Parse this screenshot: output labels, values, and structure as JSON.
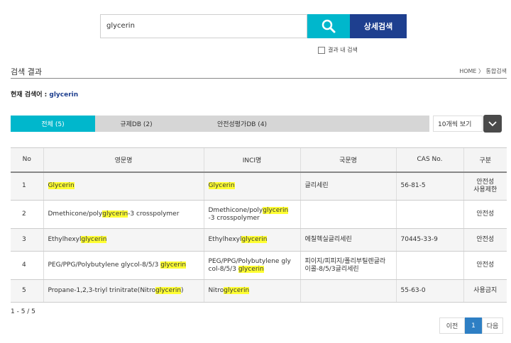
{
  "search": {
    "query": "glycerin",
    "advanced_label": "상세검색",
    "within_label": "결과 내 검색"
  },
  "section": {
    "title": "검색 결과",
    "breadcrumb": "HOME 〉 통합검색"
  },
  "keyword": {
    "label": "현재 검색어 : ",
    "value": "glycerin"
  },
  "tabs": [
    {
      "label": "전체 (5)"
    },
    {
      "label": "규제DB (2)"
    },
    {
      "label": "안전성평가DB (4)"
    }
  ],
  "per_page": {
    "selected": "10개씩 보기"
  },
  "table": {
    "headers": [
      "No",
      "영문명",
      "INCI명",
      "국문명",
      "CAS No.",
      "구분"
    ],
    "rows": [
      {
        "no": "1",
        "en": [
          "",
          "Glycerin",
          ""
        ],
        "inci": [
          "",
          "Glycerin",
          ""
        ],
        "kr": "글리세린",
        "cas": "56-81-5",
        "gubun": "안전성\n사용제한"
      },
      {
        "no": "2",
        "en": [
          "Dmethicone/poly",
          "glycerin",
          "-3 crosspolymer"
        ],
        "inci": [
          "Dmethicone/poly",
          "glycerin",
          "\n-3 crosspolymer"
        ],
        "kr": "",
        "cas": "",
        "gubun": "안전성"
      },
      {
        "no": "3",
        "en": [
          "Ethylhexyl",
          "glycerin",
          ""
        ],
        "inci": [
          "Ethylhexyl",
          "glycerin",
          ""
        ],
        "kr": "에칠헥실글리세린",
        "cas": "70445-33-9",
        "gubun": "안전성"
      },
      {
        "no": "4",
        "en": [
          "PEG/PPG/Polybutylene glycol-8/5/3 ",
          "glycerin",
          ""
        ],
        "inci": [
          "PEG/PPG/Polybutylene gly\ncol-8/5/3 ",
          "glycerin",
          ""
        ],
        "kr": "피이지/피피지/폴리부틸렌글라\n이콜-8/5/3글리세린",
        "cas": "",
        "gubun": "안전성"
      },
      {
        "no": "5",
        "en": [
          "Propane-1,2,3-triyl trinitrate(Nitro",
          "glycerin",
          ")"
        ],
        "inci": [
          "Nitro",
          "glycerin",
          ""
        ],
        "kr": "",
        "cas": "55-63-0",
        "gubun": "사용금지"
      }
    ]
  },
  "count": "1 - 5 / 5",
  "pagination": {
    "prev": "이전",
    "current": "1",
    "next": "다음"
  },
  "colors": {
    "accent": "#00b7cc",
    "navy": "#1e3f8f",
    "highlight": "#ffff33",
    "page_active": "#2e7fc4"
  }
}
